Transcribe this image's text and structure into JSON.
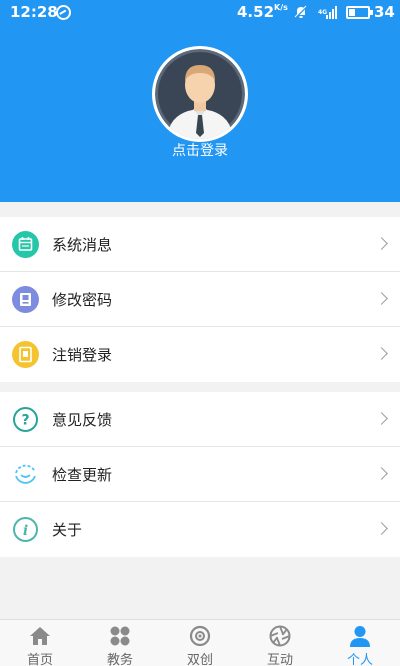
{
  "status_bar": {
    "time": "12:28",
    "net_speed": "4.52",
    "net_speed_unit": "K/s",
    "battery_level": "34",
    "battery_fraction": 0.34
  },
  "profile": {
    "login_label": "点击登录"
  },
  "menu_group_1": [
    {
      "label": "系统消息",
      "icon": "calendar-icon",
      "color": "#26c6a8"
    },
    {
      "label": "修改密码",
      "icon": "password-card-icon",
      "color": "#7e8ce0"
    },
    {
      "label": "注销登录",
      "icon": "logout-doc-icon",
      "color": "#f4c430"
    }
  ],
  "menu_group_2": [
    {
      "label": "意见反馈",
      "icon": "question-icon",
      "color": "#26a69a"
    },
    {
      "label": "检查更新",
      "icon": "update-icon",
      "color": "#4fc3f7"
    },
    {
      "label": "关于",
      "icon": "info-icon",
      "color": "#4db6ac"
    }
  ],
  "tabs": [
    {
      "label": "首页",
      "icon": "home-icon"
    },
    {
      "label": "教务",
      "icon": "grid-icon"
    },
    {
      "label": "双创",
      "icon": "innovation-icon"
    },
    {
      "label": "互动",
      "icon": "aperture-icon"
    },
    {
      "label": "个人",
      "icon": "person-icon"
    }
  ],
  "active_tab": "个人",
  "colors": {
    "primary": "#2196f3",
    "inactive_tab": "#8a8a8a",
    "background": "#f2f2f2"
  }
}
